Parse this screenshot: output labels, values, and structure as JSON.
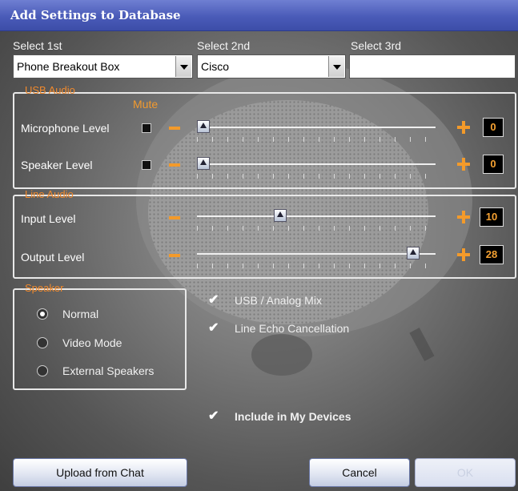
{
  "window": {
    "title": "Add Settings to Database"
  },
  "selects": {
    "first": {
      "label": "Select 1st",
      "value": "Phone Breakout Box"
    },
    "second": {
      "label": "Select 2nd",
      "value": "Cisco"
    },
    "third": {
      "label": "Select 3rd",
      "value": ""
    }
  },
  "usb_audio": {
    "title": "USB Audio",
    "mute_label": "Mute",
    "rows": [
      {
        "label": "Microphone Level",
        "value": "0",
        "level": 0.0
      },
      {
        "label": "Speaker Level",
        "value": "0",
        "level": 0.0
      }
    ]
  },
  "line_audio": {
    "title": "Line Audio",
    "rows": [
      {
        "label": "Input Level",
        "value": "10",
        "level": 0.34
      },
      {
        "label": "Output Level",
        "value": "28",
        "level": 0.93
      }
    ]
  },
  "speaker": {
    "title": "Speaker",
    "options": [
      "Normal",
      "Video Mode",
      "External Speakers"
    ],
    "selected": "Normal"
  },
  "options": {
    "usb_analog_mix": "USB / Analog Mix",
    "line_echo_cancellation": "Line Echo Cancellation",
    "include_in_my_devices": "Include in My Devices"
  },
  "buttons": {
    "upload": "Upload from Chat",
    "cancel": "Cancel",
    "ok": "OK"
  },
  "colors": {
    "accent": "#f29a2e",
    "titlebar": "#4a5bb8"
  }
}
